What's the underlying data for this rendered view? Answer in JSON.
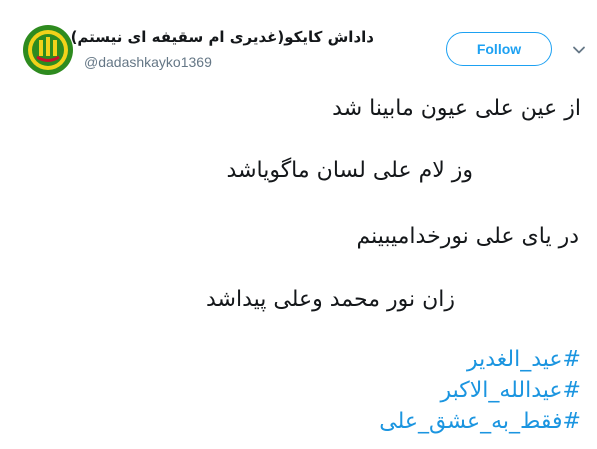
{
  "author": {
    "display_name": "داداش کایکو(غدیری ام سقیفه ای نیستم)",
    "handle": "@dadashkayko1369",
    "avatar_icon": "profile-emblem-icon"
  },
  "header": {
    "follow_label": "Follow",
    "more_icon": "chevron-down-icon"
  },
  "tweet": {
    "lines": [
      "از عین علی عیون مابینا شد",
      "وز لام علی لسان ماگویاشد",
      "در  یای علی نورخدامیبینم",
      "زان نور محمد وعلی پیداشد"
    ],
    "hashtags": [
      "#عید_الغدیر",
      "#عیدالله_الاکبر",
      "#فقط_به_عشق_علی"
    ]
  },
  "colors": {
    "text": "#14171a",
    "secondary": "#657786",
    "link": "#1b95e0",
    "accent": "#1da1f2",
    "avatar_green": "#2e8b1f",
    "avatar_yellow": "#f2d21a",
    "avatar_red": "#c8102e"
  }
}
